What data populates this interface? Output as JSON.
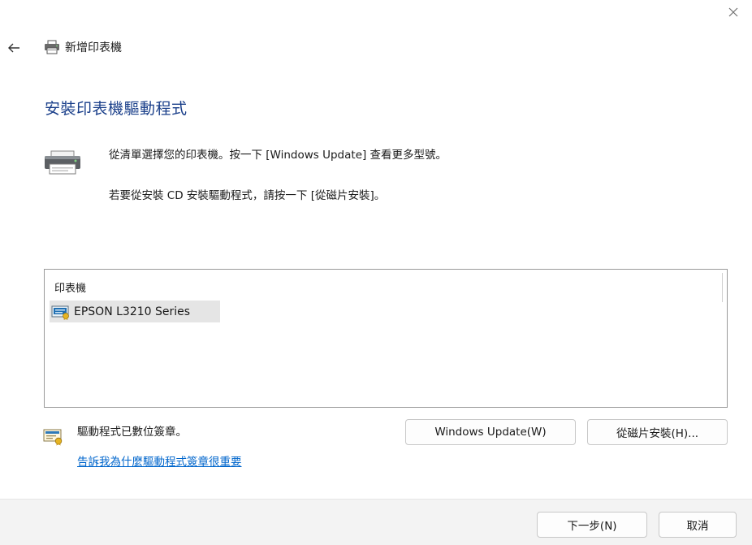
{
  "window": {
    "title": "新增印表機"
  },
  "page": {
    "heading": "安裝印表機驅動程式",
    "instruction_line1": "從清單選擇您的印表機。按一下 [Windows Update] 查看更多型號。",
    "instruction_line2": "若要從安裝 CD 安裝驅動程式，請按一下 [從磁片安裝]。"
  },
  "printer_list": {
    "column_header": "印表機",
    "items": [
      {
        "label": "EPSON L3210 Series",
        "selected": true
      }
    ]
  },
  "signature": {
    "status_text": "驅動程式已數位簽章。",
    "link_text": "告訴我為什麼驅動程式簽章很重要"
  },
  "buttons": {
    "windows_update": "Windows Update(W)",
    "have_disk": "從磁片安裝(H)...",
    "next": "下一步(N)",
    "cancel": "取消"
  },
  "colors": {
    "heading": "#1a3f8a",
    "link": "#0066cc",
    "selection": "#e5e5e5",
    "footer": "#f3f3f3"
  },
  "icons": {
    "close": "close-icon",
    "back": "back-arrow-icon",
    "title": "printer-icon",
    "printer_large": "printer-icon",
    "list_item": "certificate-printer-icon",
    "signature": "certificate-icon"
  }
}
